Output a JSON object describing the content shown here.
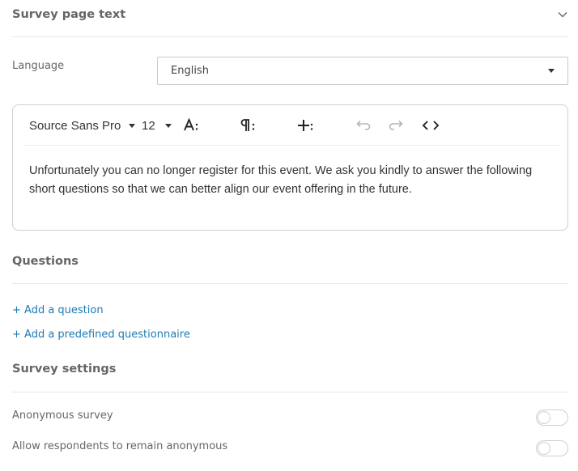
{
  "survey_page_text": {
    "title": "Survey page text",
    "collapse_icon": "chevron-down-icon"
  },
  "language": {
    "label": "Language",
    "selected": "English"
  },
  "editor": {
    "font_family": "Source Sans Pro",
    "font_size": "12",
    "tools": [
      "text-style-icon",
      "paragraph-icon",
      "insert-icon",
      "undo-icon",
      "redo-icon",
      "code-icon"
    ],
    "content": "Unfortunately you can no longer register for this event. We ask you kindly to answer the following short questions so that we can better align our event offering in the future."
  },
  "questions": {
    "title": "Questions",
    "add_question": "+ Add a question",
    "add_predefined": "+ Add a predefined questionnaire"
  },
  "survey_settings": {
    "title": "Survey settings",
    "items": [
      {
        "label": "Anonymous survey",
        "enabled": false
      },
      {
        "label": "Allow respondents to remain anonymous",
        "enabled": false
      }
    ]
  },
  "colors": {
    "link": "#1f7ab3",
    "border": "#cfcfcf"
  }
}
